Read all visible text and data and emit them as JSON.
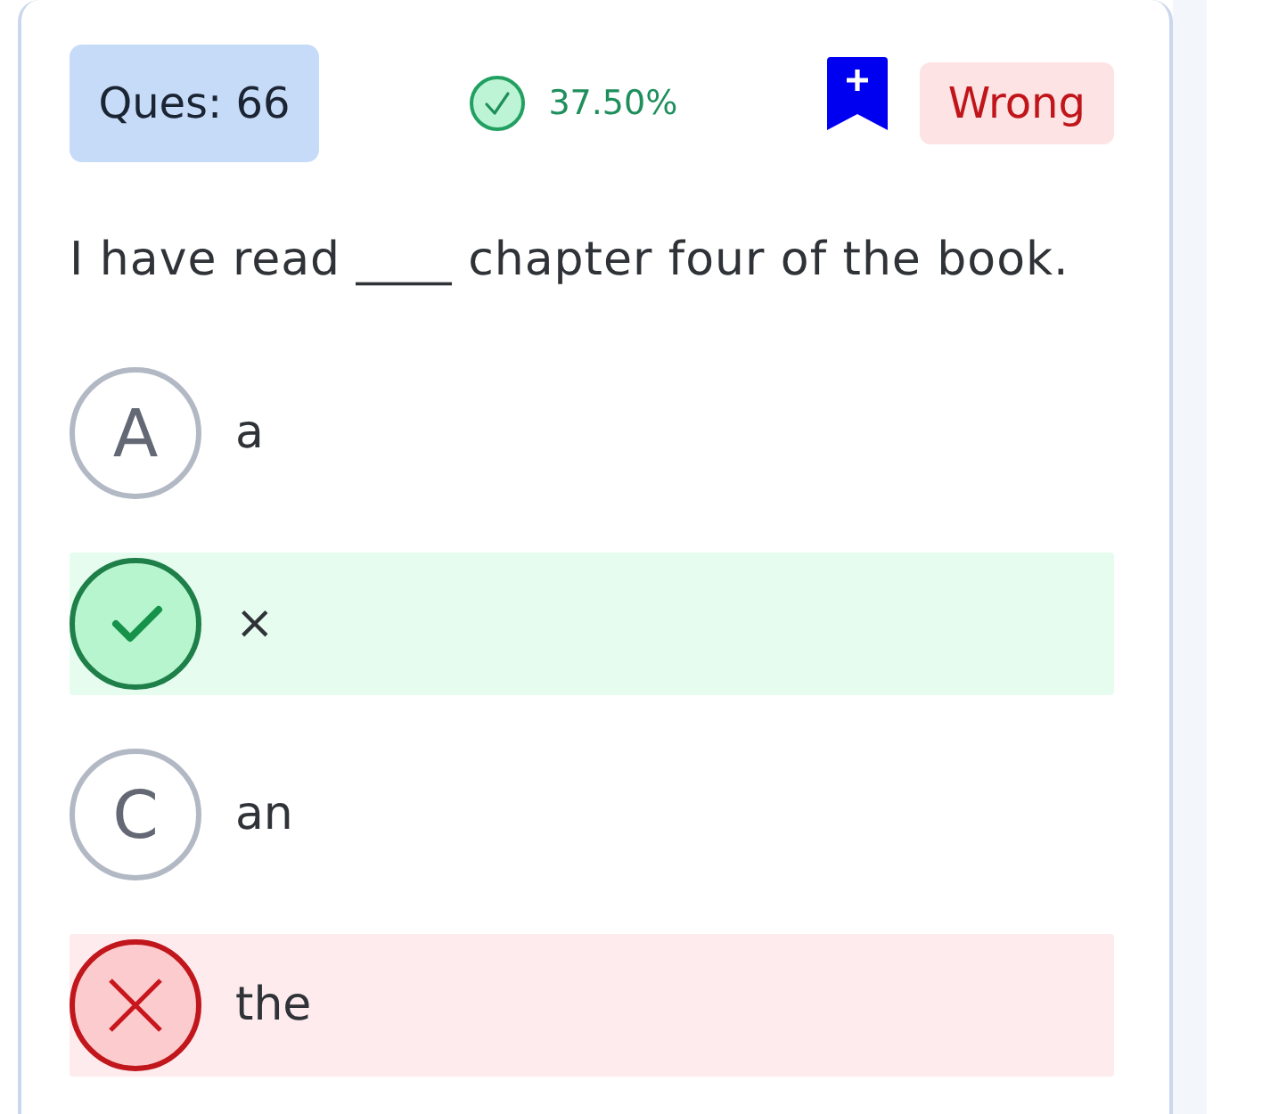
{
  "header": {
    "question_label": "Ques: 66",
    "score": "37.50%",
    "result": "Wrong"
  },
  "question": "I have read ____ chapter four of the book.",
  "options": [
    {
      "kind": "plain",
      "letter": "A",
      "text": "a"
    },
    {
      "kind": "correct",
      "text": "×"
    },
    {
      "kind": "plain",
      "letter": "C",
      "text": "an"
    },
    {
      "kind": "wrong",
      "text": "the"
    }
  ]
}
